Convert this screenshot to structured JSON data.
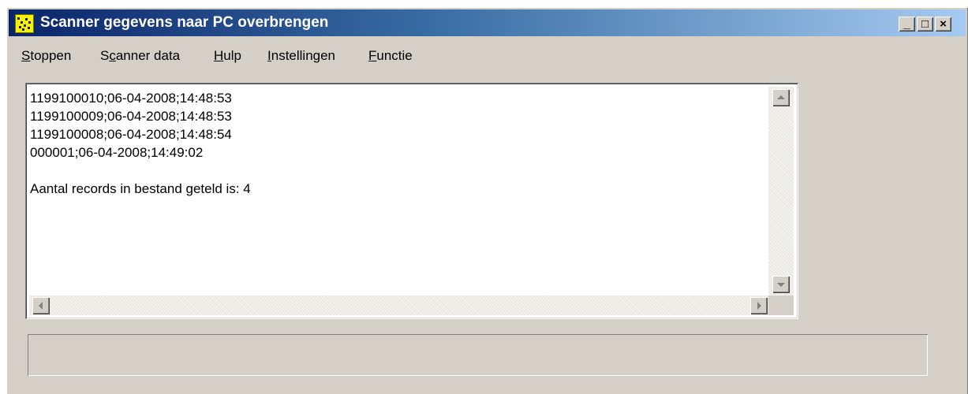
{
  "window": {
    "title": "Scanner gegevens naar PC overbrengen",
    "icon": "scanner-app-icon",
    "controls": {
      "minimize": "_",
      "maximize": "□",
      "close": "×"
    }
  },
  "menu": {
    "items": [
      {
        "label": "Stoppen",
        "mnemonic": "S",
        "rest": "toppen"
      },
      {
        "label": "Scanner data",
        "pre": "S",
        "mnemonic": "c",
        "rest": "anner data"
      },
      {
        "label": "Hulp",
        "mnemonic": "H",
        "rest": "ulp"
      },
      {
        "label": "Instellingen",
        "mnemonic": "I",
        "rest": "nstellingen"
      },
      {
        "label": "Functie",
        "mnemonic": "F",
        "rest": "unctie"
      }
    ]
  },
  "output": {
    "lines": [
      "1199100010;06-04-2008;14:48:53",
      "1199100009;06-04-2008;14:48:53",
      "1199100008;06-04-2008;14:48:54",
      "000001;06-04-2008;14:49:02",
      "",
      "Aantal records in bestand geteld is: 4"
    ]
  },
  "statusbar": {
    "text": ""
  },
  "colors": {
    "titlebar_start": "#0a246a",
    "titlebar_end": "#a6caf0",
    "face": "#d4d0c8",
    "icon_bg": "#f8f400"
  }
}
